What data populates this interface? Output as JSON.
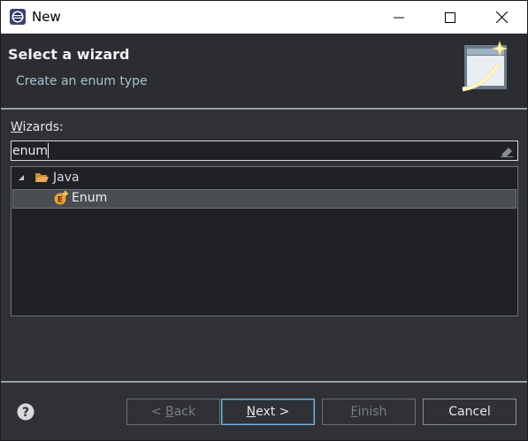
{
  "window": {
    "title": "New",
    "icon": "eclipse-icon",
    "controls": [
      "minimize-icon",
      "maximize-icon",
      "close-icon"
    ]
  },
  "banner": {
    "title": "Select a wizard",
    "description": "Create an enum type",
    "image": "wizard-banner-image"
  },
  "wizards": {
    "label_mnemonic": "W",
    "label_rest": "izards:",
    "filter_value": "enum",
    "tree": [
      {
        "label": "Java",
        "icon": "folder-open-icon",
        "expanded": true
      },
      {
        "label": "Enum",
        "icon": "enum-icon",
        "selected": true
      }
    ]
  },
  "footer": {
    "help_icon": "help-icon",
    "back_prefix": "< ",
    "back_mnemonic": "B",
    "back_rest": "ack",
    "next_mnemonic": "N",
    "next_rest": "ext >",
    "finish_mnemonic": "F",
    "finish_rest": "inish",
    "cancel_label": "Cancel"
  },
  "colors": {
    "background": "#2f3136",
    "banner": "#2b2d31",
    "selection": "#4a4d52",
    "accent_folder": "#e0a250",
    "accent_enum": "#e8a23a"
  }
}
